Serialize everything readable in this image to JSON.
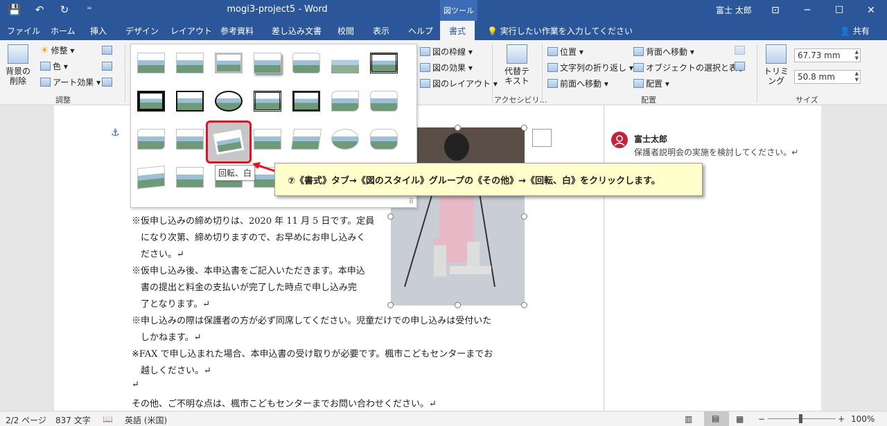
{
  "titlebar": {
    "doc_title": "mogi3-project5  -  Word",
    "contextual_tab": "図ツール",
    "user": "富士 太郎",
    "qa_save": "💾",
    "qa_undo": "↶",
    "qa_redo": "↻",
    "qa_custom": "⁼",
    "btn_ribbon_opts": "⊡",
    "btn_min": "─",
    "btn_max": "☐",
    "btn_close": "✕"
  },
  "tabs": [
    {
      "label": "ファイル"
    },
    {
      "label": "ホーム"
    },
    {
      "label": "挿入"
    },
    {
      "label": "デザイン"
    },
    {
      "label": "レイアウト"
    },
    {
      "label": "参考資料"
    },
    {
      "label": "差し込み文書"
    },
    {
      "label": "校閲"
    },
    {
      "label": "表示"
    },
    {
      "label": "ヘルプ"
    },
    {
      "label": "書式",
      "active": true
    }
  ],
  "tell_me": "💡 実行したい作業を入力してください",
  "share": "👤 共有",
  "ribbon": {
    "remove_bg": [
      "背景の",
      "削除"
    ],
    "corrections": "修整 ▾",
    "color": "色 ▾",
    "artistic": "アート効果 ▾",
    "group_adjust": "調整",
    "pic_border": "図の枠線 ▾",
    "pic_effects": "図の効果 ▾",
    "pic_layout": "図のレイアウト ▾",
    "alt_text": [
      "代替テ",
      "キスト"
    ],
    "group_access": "アクセシビリ…",
    "position": "位置 ▾",
    "wrap_text": "文字列の折り返し ▾",
    "bring_forward": "前面へ移動 ▾",
    "send_backward": "背面へ移動 ▾",
    "selection_pane": "オブジェクトの選択と表示",
    "align": "配置 ▾",
    "group_arrange": "配置",
    "crop": "トリミング",
    "height": "67.73 mm",
    "width": "50.8 mm",
    "group_size": "サイズ"
  },
  "gallery_tooltip": "回転、白",
  "callout": "⑦《書式》タブ→《図のスタイル》グループの《その他》→《回転、白》をクリックします。",
  "comment": {
    "author": "富士太郎",
    "text": "保護者説明会の実施を検討してください。↵"
  },
  "document": {
    "lines": [
      "※仮申し込みの締め切りは、2020 年 11 月 5 日です。定員",
      "　になり次第、締め切りますので、お早めにお申し込みく",
      "　ださい。↵",
      "※仮申し込み後、本申込書をご記入いただきます。本申込",
      "　書の提出と料金の支払いが完了した時点で申し込み完",
      "　了となります。↵",
      "※申し込みの際は保護者の方が必ず同席してください。児童だけでの申し込みは受付いた",
      "　しかねます。↵",
      "※FAX で申し込まれた場合、本申込書の受け取りが必要です。楓市こどもセンターまでお",
      "　越しください。↵",
      "↵",
      "その他、ご不明な点は、楓市こどもセンターまでお問い合わせください。↵"
    ]
  },
  "statusbar": {
    "page": "2/2 ページ",
    "words": "837 文字",
    "lang": "英語 (米国)",
    "zoom": "100%"
  }
}
